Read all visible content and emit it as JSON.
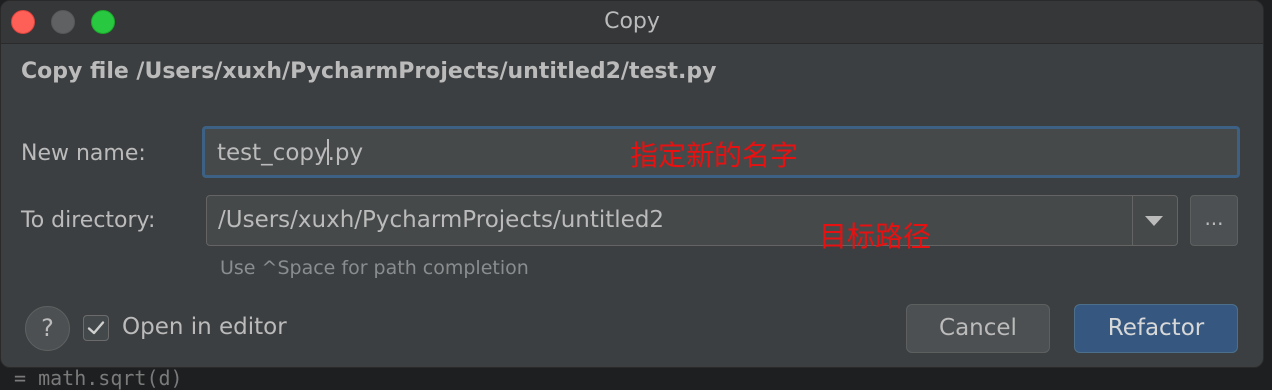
{
  "window": {
    "title": "Copy"
  },
  "header": {
    "text": "Copy file /Users/xuxh/PycharmProjects/untitled2/test.py"
  },
  "form": {
    "new_name_label": "New name:",
    "new_name_before_caret": "test_copy",
    "new_name_after_caret": ".py",
    "to_directory_label": "To directory:",
    "to_directory_value": "/Users/xuxh/PycharmProjects/untitled2",
    "browse_label": "...",
    "hint": "Use ^Space for path completion"
  },
  "annotations": {
    "new_name_note": "指定新的名字",
    "directory_note": "目标路径"
  },
  "footer": {
    "help_label": "?",
    "open_in_editor_label": "Open in editor",
    "open_in_editor_checked": true,
    "cancel_label": "Cancel",
    "refactor_label": "Refactor"
  },
  "background": {
    "code_fragment": "= math.sqrt(d)"
  },
  "colors": {
    "dialog_bg": "#3c3f41",
    "default_button": "#365880",
    "focus_border": "#3d6185",
    "annotation_red": "#e81111"
  },
  "icons": {
    "dropdown": "chevron-down-icon",
    "checkbox": "checkmark-icon"
  }
}
